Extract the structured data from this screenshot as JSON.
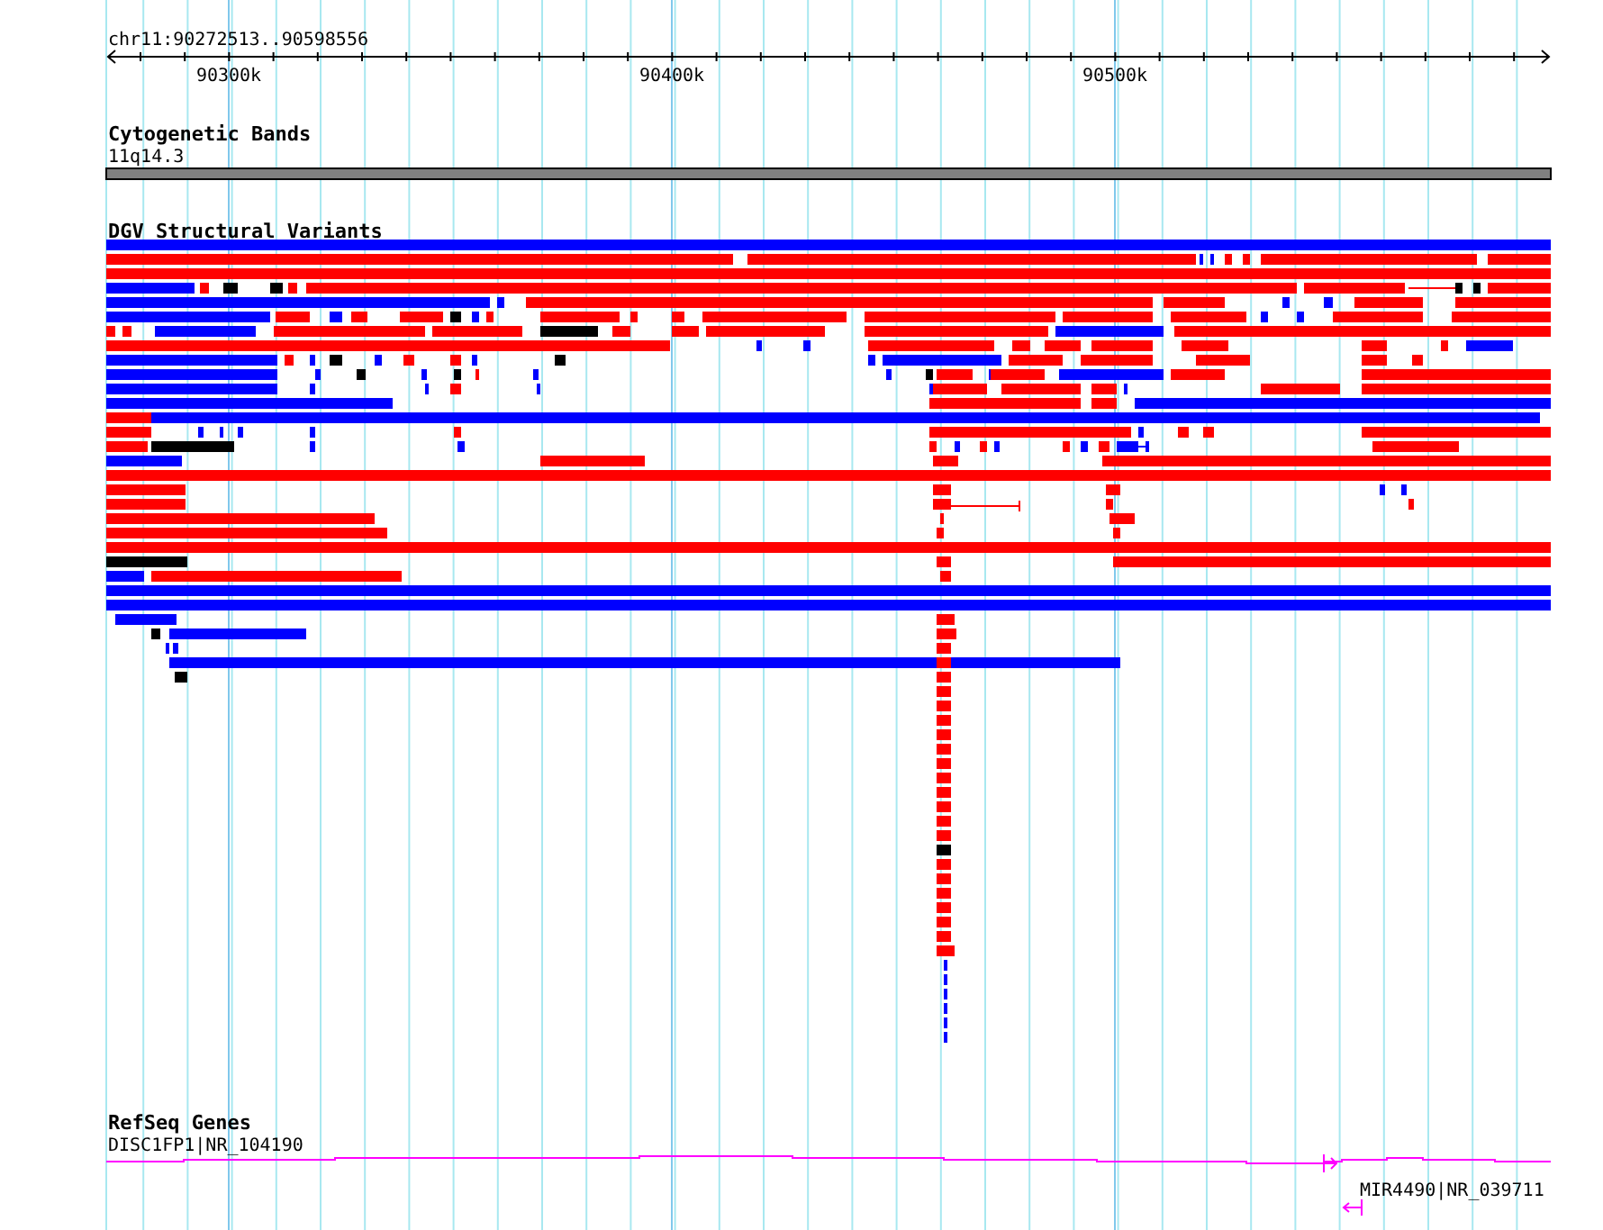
{
  "ruler": {
    "label": "chr11:90272513..90598556",
    "ticks": [
      {
        "label": "90300k"
      },
      {
        "label": "90400k"
      },
      {
        "label": "90500k"
      }
    ]
  },
  "tracks": [
    {
      "kind": "bands",
      "title": "Cytogenetic Bands",
      "label": "11q14.3"
    },
    {
      "kind": "variants",
      "title": "DGV Structural Variants"
    },
    {
      "kind": "genes",
      "title": "RefSeq Genes",
      "genes": [
        {
          "label": "DISC1FP1|NR_104190"
        },
        {
          "label": "MIR4490|NR_039711"
        }
      ]
    }
  ]
}
